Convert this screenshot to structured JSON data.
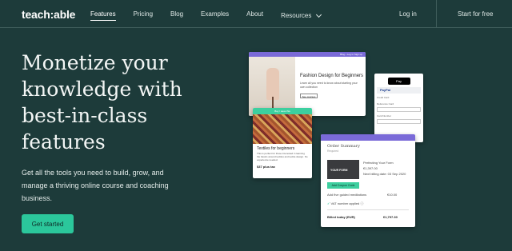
{
  "nav": {
    "logo": "teach:able",
    "links": [
      "Features",
      "Pricing",
      "Blog",
      "Examples",
      "About",
      "Resources"
    ],
    "active": "Features",
    "login": "Log in",
    "start_free": "Start for free"
  },
  "hero": {
    "headline": "Monetize your knowledge with best-in-class features",
    "subtext": "Get all the tools you need to build, grow, and manage a thriving online course and coaching business.",
    "cta": "Get started"
  },
  "mockups": {
    "course_page": {
      "topbar": "Blog • Log in Sign up",
      "title": "Fashion Design for Beginners",
      "description": "Learn all you need to know about starting your own collection",
      "button": "See courses"
    },
    "product_card": {
      "button": "Buy / save this",
      "title": "Textiles for beginners",
      "description": "This is perfect for those interested in learning the basics around textiles and textile design. No experience needed.",
      "price": "$37 plus tax"
    },
    "payment": {
      "apple_pay": "Pay",
      "paypal": "PayPal",
      "card_label": "Credit Card",
      "field1": "Reference Card",
      "field2": "Card Number"
    },
    "order": {
      "title": "Order Summary",
      "subtitle": "Required",
      "thumb_text": "YOUR FORM",
      "product_name": "Perfecting Your Form",
      "product_price": "€1,397.00",
      "billing_note": "Next billing date: 03 Sep 2020",
      "coupon": "Add Coupon Code",
      "addon_label": "Add five guided meditations",
      "addon_price": "€10.00",
      "vat": "VAT number applied",
      "billed_label": "Billed today (EUR)",
      "billed_price": "€1,797.30"
    }
  }
}
